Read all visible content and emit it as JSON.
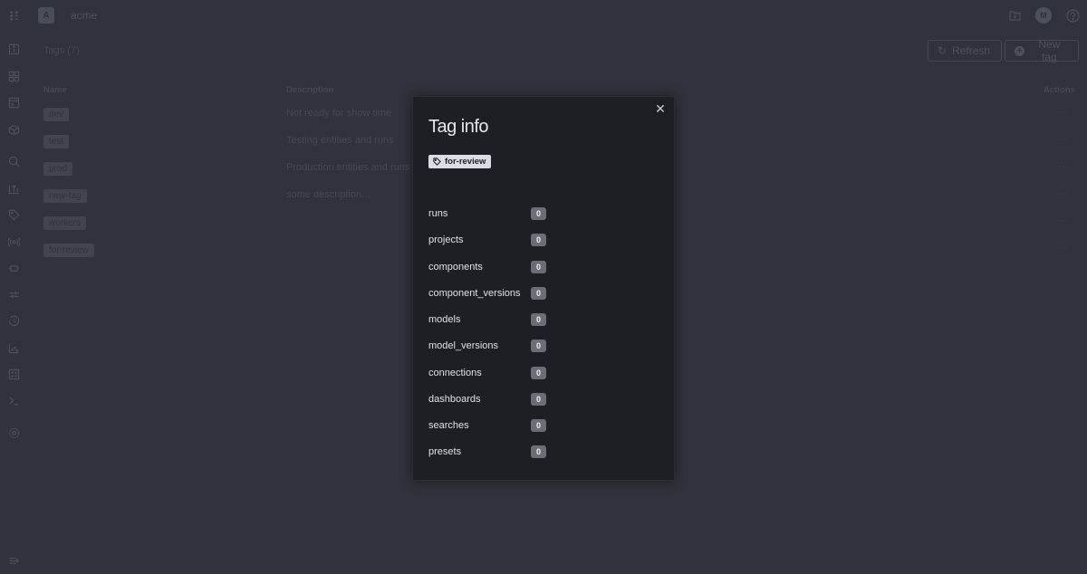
{
  "org": {
    "initial": "A",
    "name": "acme"
  },
  "user": {
    "initial": "M"
  },
  "page": {
    "title": "Tags (7)",
    "refresh_label": "Refresh",
    "new_tag_label": "New tag"
  },
  "table": {
    "columns": [
      "Name",
      "Description",
      "Actions"
    ],
    "rows": [
      {
        "name": "dev",
        "description": "Not ready for show time"
      },
      {
        "name": "test",
        "description": "Testing entities and runs"
      },
      {
        "name": "prod",
        "description": "Production entities and runs"
      },
      {
        "name": "new-tag",
        "description": "some description..."
      },
      {
        "name": "workers",
        "description": ""
      },
      {
        "name": "for-review",
        "description": ""
      }
    ],
    "action_glyph": "···"
  },
  "sidebar": {
    "icons": [
      "grid-dots-icon",
      "info-icon",
      "dashboard-icon",
      "terminal-window-icon",
      "cube-icon",
      "search-icon",
      "upload-chart-icon",
      "tag-icon",
      "broadcast-icon",
      "plug-icon",
      "sliders-icon",
      "history-icon",
      "scatter-chart-icon",
      "grid-icon",
      "console-icon",
      "settings-icon",
      "collapse-icon"
    ]
  },
  "modal": {
    "title": "Tag info",
    "tag": "for-review",
    "close_glyph": "✕",
    "counts": [
      {
        "label": "runs",
        "value": "0"
      },
      {
        "label": "projects",
        "value": "0"
      },
      {
        "label": "components",
        "value": "0"
      },
      {
        "label": "component_versions",
        "value": "0"
      },
      {
        "label": "models",
        "value": "0"
      },
      {
        "label": "model_versions",
        "value": "0"
      },
      {
        "label": "connections",
        "value": "0"
      },
      {
        "label": "dashboards",
        "value": "0"
      },
      {
        "label": "searches",
        "value": "0"
      },
      {
        "label": "presets",
        "value": "0"
      }
    ]
  }
}
